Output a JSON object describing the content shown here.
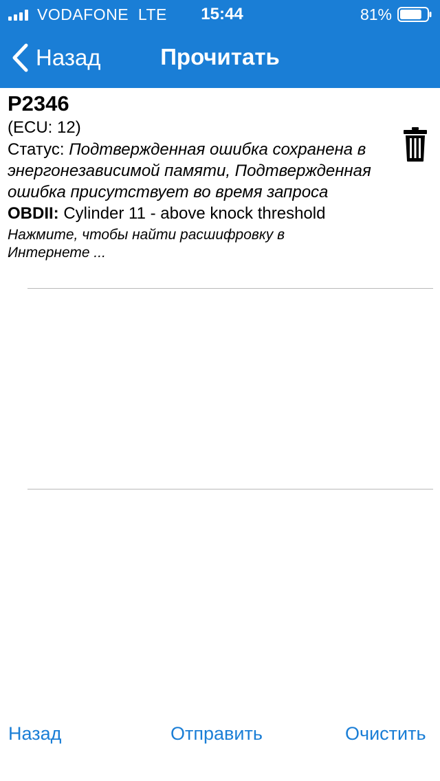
{
  "status_bar": {
    "carrier": "VODAFONE",
    "network": "LTE",
    "time": "15:44",
    "battery_percent": "81%",
    "battery_level": 0.81
  },
  "nav": {
    "back_label": "Назад",
    "title": "Прочитать"
  },
  "error": {
    "code": "P2346",
    "ecu": "(ECU: 12)",
    "status_label": "Статус:",
    "status_value": "Подтвержденная ошибка сохранена в энергонезависимой памяти, Подтвержденная ошибка присутствует во время запроса",
    "obd_label": "OBDII:",
    "obd_value": "Cylinder 11 - above knock threshold",
    "hint": "Нажмите, чтобы найти расшифровку в Интернете ..."
  },
  "toolbar": {
    "back_label": "Назад",
    "send_label": "Отправить",
    "clear_label": "Очистить"
  },
  "colors": {
    "accent": "#1a7ed6"
  }
}
